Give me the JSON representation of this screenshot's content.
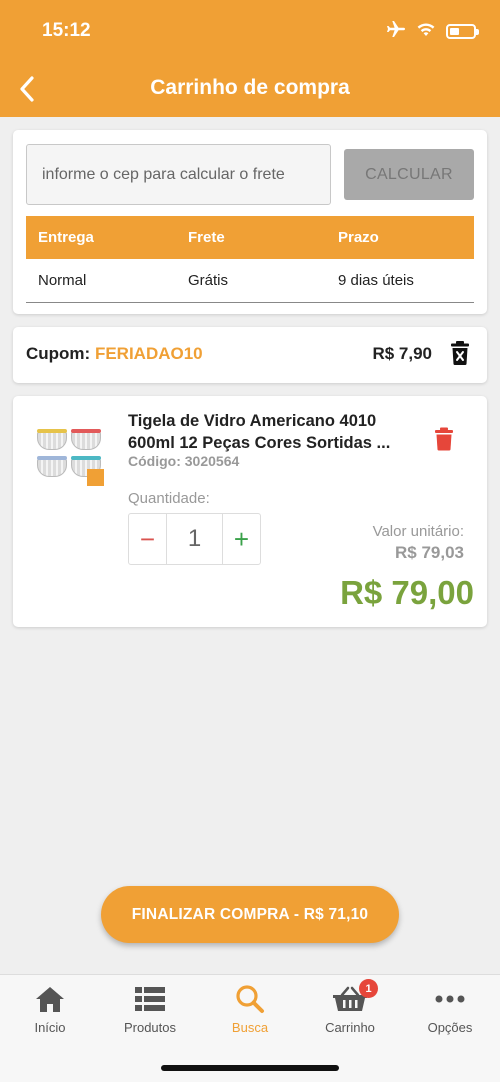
{
  "status_bar": {
    "time": "15:12"
  },
  "header": {
    "title": "Carrinho de compra"
  },
  "shipping": {
    "cep_placeholder": "informe o cep para calcular o frete",
    "calculate_label": "CALCULAR",
    "columns": [
      "Entrega",
      "Frete",
      "Prazo"
    ],
    "rows": [
      {
        "entrega": "Normal",
        "frete": "Grátis",
        "prazo": "9 dias úteis"
      }
    ]
  },
  "coupon": {
    "label": "Cupom:",
    "code": "FERIADAO10",
    "value": "R$ 7,90"
  },
  "cart_item": {
    "name_line1": "Tigela de Vidro Americano 4010",
    "name_line2": "600ml 12 Peças Cores Sortidas ...",
    "code": "Código: 3020564",
    "quantity_label": "Quantidade:",
    "quantity": "1",
    "minus": "−",
    "plus": "+",
    "unit_label": "Valor unitário:",
    "unit_price": "R$ 79,03",
    "total": "R$ 79,00"
  },
  "checkout": {
    "label": "FINALIZAR COMPRA - R$ 71,10"
  },
  "tabbar": {
    "items": [
      {
        "label": "Início",
        "icon": "home-icon"
      },
      {
        "label": "Produtos",
        "icon": "list-icon"
      },
      {
        "label": "Busca",
        "icon": "search-icon",
        "active": true
      },
      {
        "label": "Carrinho",
        "icon": "basket-icon",
        "badge": "1"
      },
      {
        "label": "Opções",
        "icon": "more-icon"
      }
    ]
  },
  "colors": {
    "primary": "#f0a035",
    "price_green": "#7aa33d",
    "delete_red": "#e6463a",
    "calc_disabled": "#a9a9a9"
  }
}
